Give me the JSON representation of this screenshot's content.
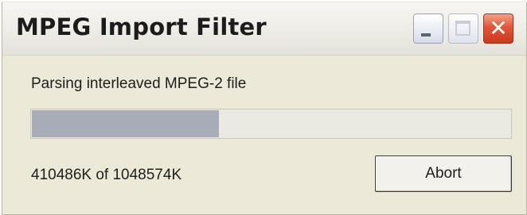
{
  "window": {
    "title": "MPEG Import Filter"
  },
  "titlebar": {
    "minimize_icon": "minimize-icon",
    "maximize_icon": "maximize-icon",
    "close_icon": "close-icon",
    "close_glyph": "✕",
    "close_color": "#e2553a"
  },
  "dialog": {
    "status_text": "Parsing interleaved MPEG-2 file",
    "progress": {
      "current_k": 410486,
      "total_k": 1048574,
      "fraction": 0.3915
    },
    "count_text": "410486K of 1048574K",
    "abort_label": "Abort"
  }
}
